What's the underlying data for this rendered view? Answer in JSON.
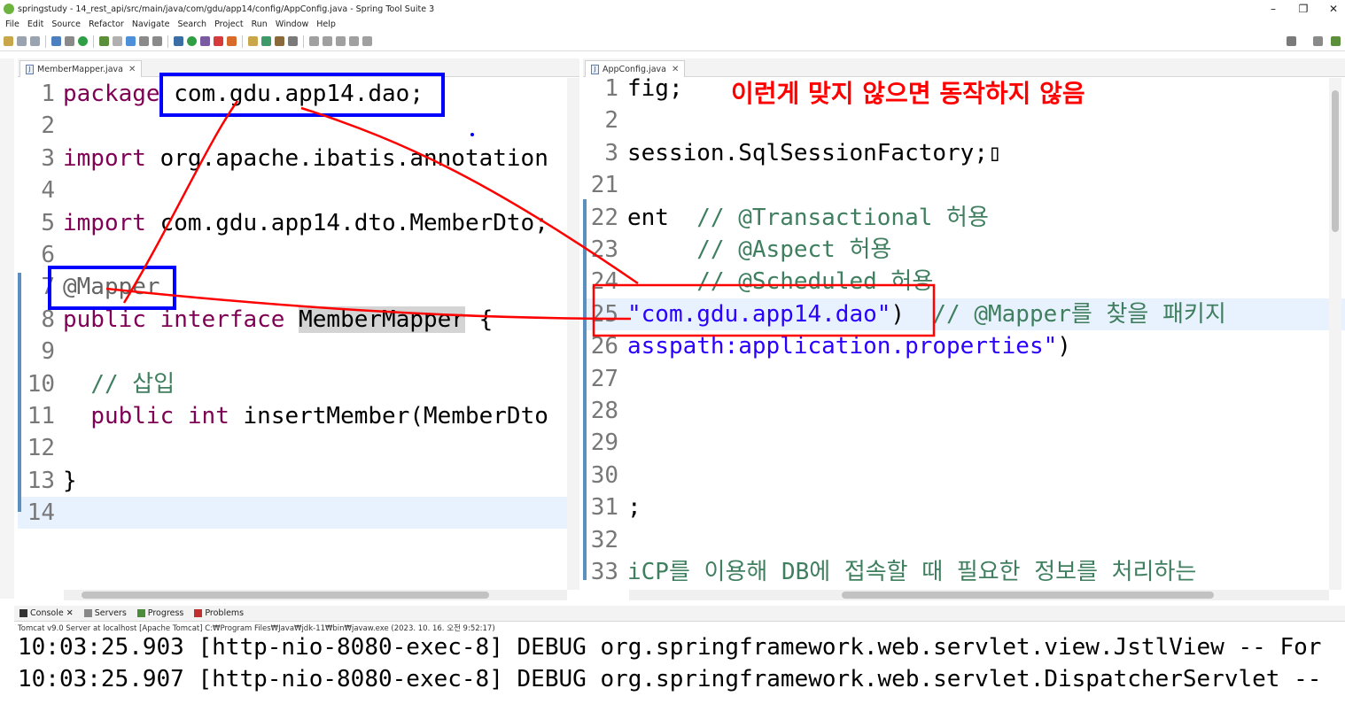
{
  "window": {
    "title": "springstudy - 14_rest_api/src/main/java/com/gdu/app14/config/AppConfig.java - Spring Tool Suite 3",
    "min_label": "–",
    "max_label": "❐",
    "close_label": "✕"
  },
  "menu": [
    "File",
    "Edit",
    "Source",
    "Refactor",
    "Navigate",
    "Search",
    "Project",
    "Run",
    "Window",
    "Help"
  ],
  "left_editor": {
    "tab_label": "MemberMapper.java",
    "lines": [
      {
        "n": "1",
        "parts": [
          [
            "kw",
            "package"
          ],
          [
            "",
            " com.gdu.app14.dao;"
          ]
        ]
      },
      {
        "n": "2",
        "parts": []
      },
      {
        "n": "3",
        "parts": [
          [
            "kw",
            "import"
          ],
          [
            "",
            " org.apache.ibatis.annotation"
          ]
        ]
      },
      {
        "n": "4",
        "parts": []
      },
      {
        "n": "5",
        "parts": [
          [
            "kw",
            "import"
          ],
          [
            "",
            " com.gdu.app14.dto.MemberDto;"
          ]
        ]
      },
      {
        "n": "6",
        "parts": []
      },
      {
        "n": "7",
        "parts": [
          [
            "ann",
            "@Mapper"
          ]
        ]
      },
      {
        "n": "8",
        "parts": [
          [
            "kw",
            "public"
          ],
          [
            "",
            " "
          ],
          [
            "kw",
            "interface"
          ],
          [
            "",
            " "
          ],
          [
            "sel",
            "MemberMapper"
          ],
          [
            "",
            " {"
          ]
        ]
      },
      {
        "n": "9",
        "parts": []
      },
      {
        "n": "10",
        "parts": [
          [
            "",
            "  "
          ],
          [
            "cmt",
            "// 삽입"
          ]
        ]
      },
      {
        "n": "11",
        "parts": [
          [
            "",
            "  "
          ],
          [
            "kw",
            "public"
          ],
          [
            "",
            " "
          ],
          [
            "kw",
            "int"
          ],
          [
            "",
            " insertMember(MemberDto"
          ]
        ]
      },
      {
        "n": "12",
        "parts": []
      },
      {
        "n": "13",
        "parts": [
          [
            "",
            "}"
          ]
        ]
      },
      {
        "n": "14",
        "parts": []
      }
    ]
  },
  "right_editor": {
    "tab_label": "AppConfig.java",
    "lines": [
      {
        "n": "1",
        "parts": [
          [
            "",
            "fig;"
          ]
        ]
      },
      {
        "n": "2",
        "parts": []
      },
      {
        "n": "3",
        "parts": [
          [
            "",
            "session.SqlSessionFactory;▯"
          ]
        ]
      },
      {
        "n": "21",
        "parts": []
      },
      {
        "n": "22",
        "parts": [
          [
            "",
            "ent  "
          ],
          [
            "cmt",
            "// @Transactional 허용"
          ]
        ]
      },
      {
        "n": "23",
        "parts": [
          [
            "",
            "     "
          ],
          [
            "cmt",
            "// @Aspect 허용"
          ]
        ]
      },
      {
        "n": "24",
        "parts": [
          [
            "",
            "     "
          ],
          [
            "cmt",
            "// @Scheduled 허용"
          ]
        ]
      },
      {
        "n": "25",
        "parts": [
          [
            "str",
            "\"com.gdu.app14.dao\""
          ],
          [
            "",
            ")  "
          ],
          [
            "cmt",
            "// @Mapper를 찾을 패키지"
          ]
        ]
      },
      {
        "n": "26",
        "parts": [
          [
            "str",
            "asspath:application.properties\""
          ],
          [
            "",
            ")"
          ]
        ]
      },
      {
        "n": "27",
        "parts": []
      },
      {
        "n": "28",
        "parts": []
      },
      {
        "n": "29",
        "parts": []
      },
      {
        "n": "30",
        "parts": []
      },
      {
        "n": "31",
        "parts": [
          [
            "",
            ";"
          ]
        ]
      },
      {
        "n": "32",
        "parts": []
      },
      {
        "n": "33",
        "parts": [
          [
            "cmt",
            "iCP를 이용해 DB에 접속할 때 필요한 정보를 처리하는"
          ]
        ]
      }
    ]
  },
  "annotation_note": "이런게 맞지 않으면 동작하지 않음",
  "console": {
    "tabs": [
      "Console",
      "Servers",
      "Progress",
      "Problems"
    ],
    "server_info": "Tomcat v9.0 Server at localhost [Apache Tomcat] C:₩Program Files₩Java₩jdk-11₩bin₩javaw.exe  (2023. 10. 16. 오전 9:52:17)",
    "lines": [
      "10:03:25.903 [http-nio-8080-exec-8] DEBUG org.springframework.web.servlet.view.JstlView -- For",
      "10:03:25.907 [http-nio-8080-exec-8] DEBUG org.springframework.web.servlet.DispatcherServlet --"
    ]
  },
  "colors": {
    "keyword": "#7f0055",
    "string": "#2a00ff",
    "comment": "#3f7f5f",
    "annotation_box": "#0000ff",
    "annotation_line": "#ff0000"
  }
}
